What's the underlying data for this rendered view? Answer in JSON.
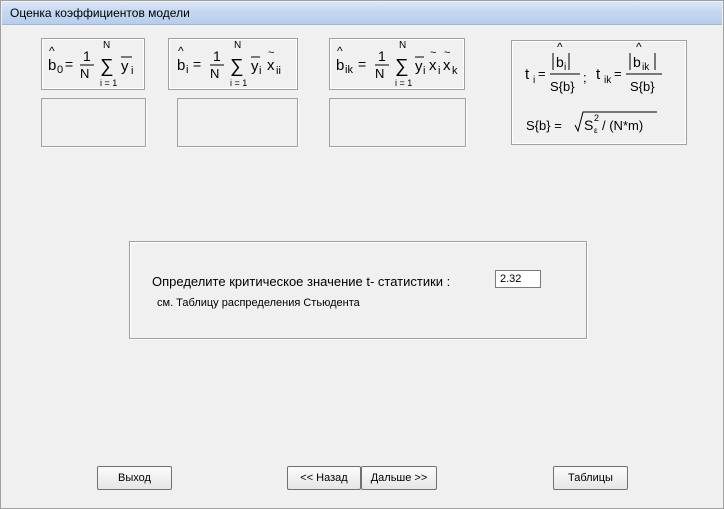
{
  "window": {
    "title": "Оценка коэффициентов модели"
  },
  "formulas": {
    "b0": {
      "lhs": "b",
      "sub": "0",
      "eq": "=",
      "num": "1",
      "den": "N",
      "sum_top": "N",
      "sum_bottom": "i = 1",
      "term": "y",
      "term_sub": "i"
    },
    "bi": {
      "lhs": "b",
      "sub": "i",
      "eq": "=",
      "num": "1",
      "den": "N",
      "sum_top": "N",
      "sum_bottom": "i = 1",
      "term": "y",
      "term_sub": "i",
      "term2": "x",
      "term2_sub": "ii"
    },
    "bik": {
      "lhs": "b",
      "sub": "ik",
      "eq": "=",
      "num": "1",
      "den": "N",
      "sum_top": "N",
      "sum_bottom": "i = 1",
      "term": "y",
      "term_sub": "i",
      "term2": "x",
      "term2_sub": "i",
      "term3": "x",
      "term3_sub": "k"
    },
    "t": {
      "ti": "t",
      "ti_sub": "i",
      "tik": "t",
      "tik_sub": "ik",
      "eq": "=",
      "num_i": "b",
      "num_i_sub": "i",
      "num_ik": "b",
      "num_ik_sub": "ik",
      "den": "S{b}",
      "sep": ";",
      "s_lhs": "S{b} =",
      "s_rad": "S",
      "s_sup": "2",
      "s_sub": "ε",
      "s_tail": "/ (N*m)"
    }
  },
  "results": {
    "b0": "",
    "bi": "",
    "bik": ""
  },
  "critical": {
    "prompt": "Определите критическое значение t- статистики :",
    "value": "2.32",
    "reference": "см. Таблицу распределения Стьюдента"
  },
  "buttons": {
    "exit": "Выход",
    "back": "<< Назад",
    "next": "Дальше >>",
    "tables": "Таблицы"
  }
}
